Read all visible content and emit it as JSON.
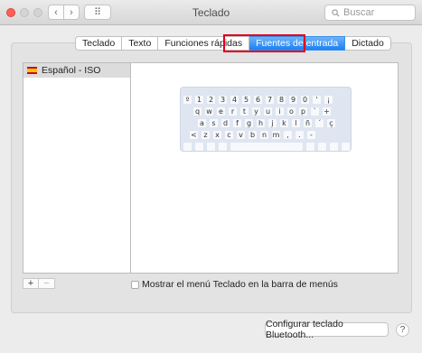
{
  "window": {
    "title": "Teclado"
  },
  "toolbar": {
    "back": "‹",
    "forward": "›",
    "grid": "⠿",
    "search_placeholder": "Buscar"
  },
  "tabs": [
    {
      "label": "Teclado",
      "selected": false
    },
    {
      "label": "Texto",
      "selected": false
    },
    {
      "label": "Funciones rápidas",
      "selected": false
    },
    {
      "label": "Fuentes de entrada",
      "selected": true
    },
    {
      "label": "Dictado",
      "selected": false
    }
  ],
  "sources": [
    {
      "label": "Español - ISO",
      "icon": "spain-flag-icon"
    }
  ],
  "keyboard_rows": [
    [
      "º",
      "1",
      "2",
      "3",
      "4",
      "5",
      "6",
      "7",
      "8",
      "9",
      "0",
      "'",
      "¡"
    ],
    [
      "q",
      "w",
      "e",
      "r",
      "t",
      "y",
      "u",
      "i",
      "o",
      "p",
      "`",
      "+"
    ],
    [
      "a",
      "s",
      "d",
      "f",
      "g",
      "h",
      "j",
      "k",
      "l",
      "ñ",
      "´",
      "ç"
    ],
    [
      "<",
      "z",
      "x",
      "c",
      "v",
      "b",
      "n",
      "m",
      ",",
      ".",
      "-"
    ]
  ],
  "controls": {
    "add": "+",
    "remove": "−"
  },
  "show_menu_checkbox": {
    "label": "Mostrar el menú Teclado en la barra de menús",
    "checked": false
  },
  "bluetooth_button": "Configurar teclado Bluetooth...",
  "help": "?"
}
